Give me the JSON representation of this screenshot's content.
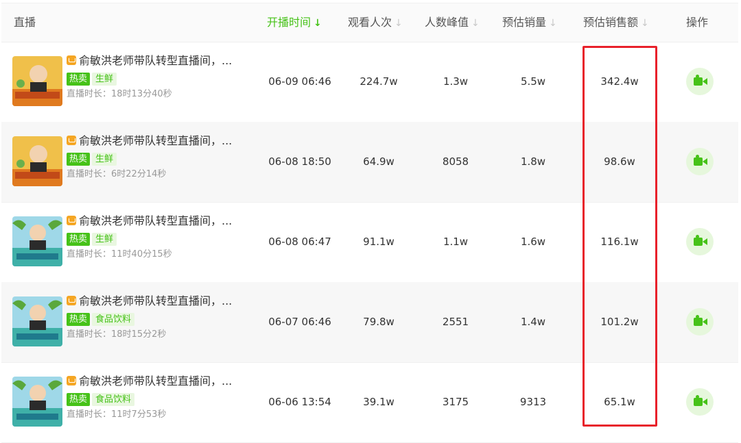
{
  "header": {
    "live": "直播",
    "start_time": "开播时间",
    "views": "观看人次",
    "peak": "人数峰值",
    "est_sales": "预估销量",
    "est_revenue": "预估销售额",
    "action": "操作",
    "sort_active_arrow": "↓",
    "sort_arrow": "↓"
  },
  "colors": {
    "accent": "#46c218",
    "highlight_border": "#e8202a",
    "tag_hot_bg": "#46c218",
    "tag_cat_bg": "#e9f7e0"
  },
  "rows": [
    {
      "title": "俞敏洪老师带队转型直播间，...",
      "tag_hot": "热卖",
      "tag_category": "生鲜",
      "duration": "直播时长：18时13分40秒",
      "start_time": "06-09 06:46",
      "views": "224.7w",
      "peak": "1.3w",
      "est_sales": "5.5w",
      "est_revenue": "342.4w",
      "thumb": "orange"
    },
    {
      "title": "俞敏洪老师带队转型直播间，...",
      "tag_hot": "热卖",
      "tag_category": "生鲜",
      "duration": "直播时长：6时22分14秒",
      "start_time": "06-08 18:50",
      "views": "64.9w",
      "peak": "8058",
      "est_sales": "1.8w",
      "est_revenue": "98.6w",
      "thumb": "orange"
    },
    {
      "title": "俞敏洪老师带队转型直播间，...",
      "tag_hot": "热卖",
      "tag_category": "生鲜",
      "duration": "直播时长：11时40分15秒",
      "start_time": "06-08 06:47",
      "views": "91.1w",
      "peak": "1.1w",
      "est_sales": "1.6w",
      "est_revenue": "116.1w",
      "thumb": "teal"
    },
    {
      "title": "俞敏洪老师带队转型直播间，...",
      "tag_hot": "热卖",
      "tag_category": "食品饮料",
      "duration": "直播时长：18时15分2秒",
      "start_time": "06-07 06:46",
      "views": "79.8w",
      "peak": "2551",
      "est_sales": "1.4w",
      "est_revenue": "101.2w",
      "thumb": "teal"
    },
    {
      "title": "俞敏洪老师带队转型直播间，...",
      "tag_hot": "热卖",
      "tag_category": "食品饮料",
      "duration": "直播时长：11时7分53秒",
      "start_time": "06-06 13:54",
      "views": "39.1w",
      "peak": "3175",
      "est_sales": "9313",
      "est_revenue": "65.1w",
      "thumb": "teal"
    }
  ]
}
